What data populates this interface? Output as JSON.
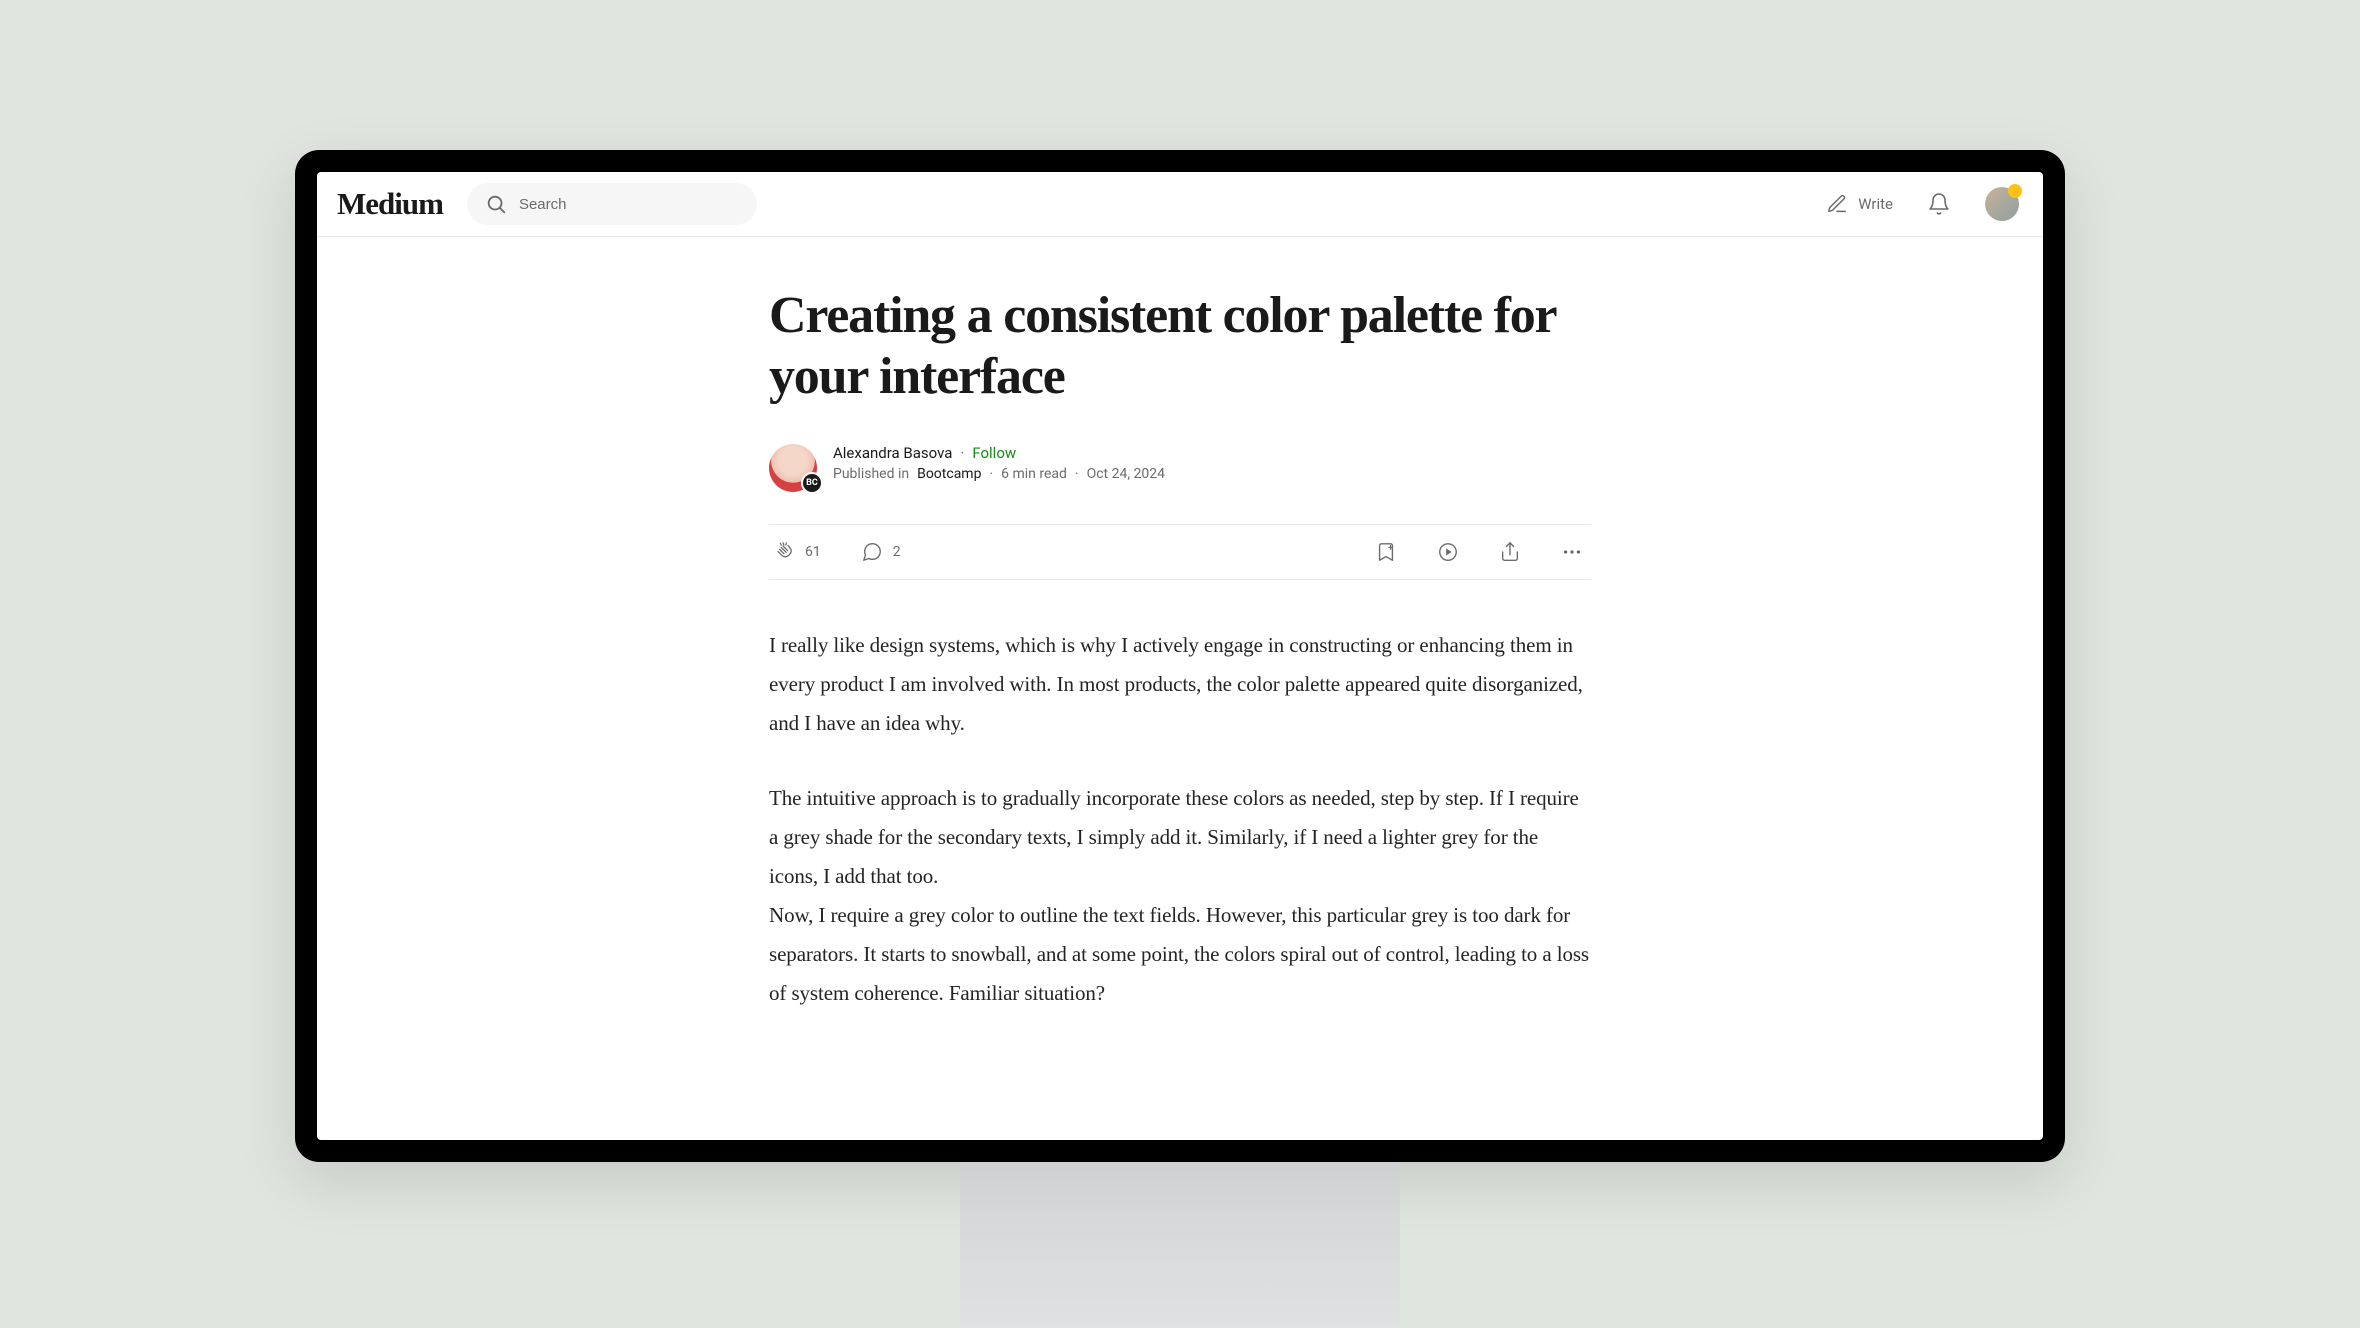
{
  "header": {
    "logo": "Medium",
    "search_placeholder": "Search",
    "write_label": "Write"
  },
  "article": {
    "title": "Creating a consistent color palette for your interface",
    "author": "Alexandra Basova",
    "follow": "Follow",
    "published_in_prefix": "Published in",
    "publication": "Bootcamp",
    "read_time": "6 min read",
    "date": "Oct 24, 2024",
    "pub_badge": "BC"
  },
  "engagement": {
    "claps": "61",
    "comments": "2"
  },
  "body": {
    "p1": "I really like design systems, which is why I actively engage in constructing or enhancing them in every product I am involved with. In most products, the color palette appeared quite disorganized, and I have an idea why.",
    "p2": "The intuitive approach is to gradually incorporate these colors as needed, step by step. If I require a grey shade for the secondary texts, I simply add it. Similarly, if I need a lighter grey for the icons, I add that too.\nNow, I require a grey color to outline the text fields. However, this particular grey is too dark for separators. It starts to snowball, and at some point, the colors spiral out of control, leading to a loss of system coherence. Familiar situation?"
  }
}
